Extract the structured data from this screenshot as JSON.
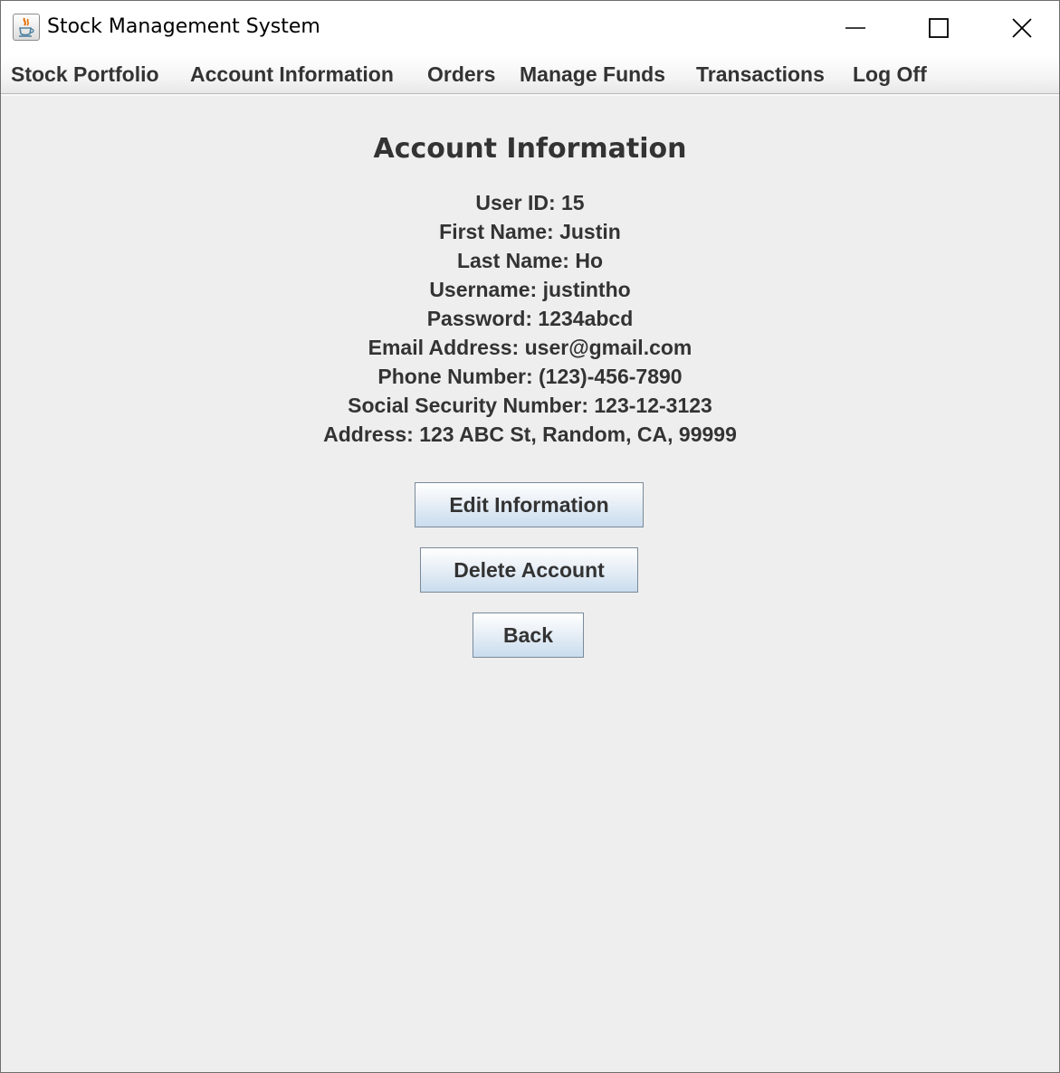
{
  "window": {
    "title": "Stock Management System",
    "icon": "java-cup-icon"
  },
  "menu": {
    "items": [
      {
        "label": "Stock Portfolio"
      },
      {
        "label": "Account Information"
      },
      {
        "label": "Orders"
      },
      {
        "label": "Manage Funds"
      },
      {
        "label": "Transactions"
      },
      {
        "label": "Log Off"
      }
    ]
  },
  "page": {
    "title": "Account Information",
    "fields": [
      "User ID: 15",
      "First Name: Justin",
      "Last Name: Ho",
      "Username: justintho",
      "Password: 1234abcd",
      "Email Address: user@gmail.com",
      "Phone Number: (123)-456-7890",
      "Social Security Number: 123-12-3123",
      "Address: 123 ABC St, Random, CA, 99999"
    ]
  },
  "buttons": {
    "edit": "Edit Information",
    "delete": "Delete Account",
    "back": "Back"
  },
  "colors": {
    "background": "#eeeeee",
    "text": "#333333",
    "button_gradient_bottom": "#c9dcee"
  }
}
